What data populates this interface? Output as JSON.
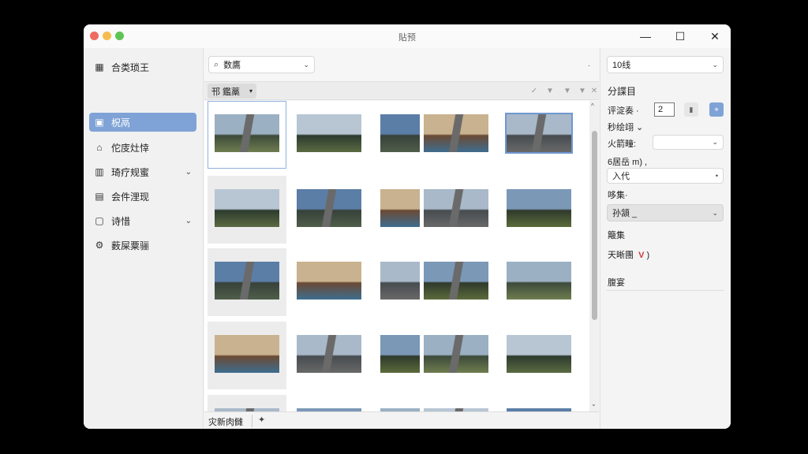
{
  "window": {
    "title": "貼预",
    "min_icon": "—",
    "max_icon": "☐",
    "close_icon": "✕"
  },
  "sidebar": {
    "items": [
      {
        "icon": "▦",
        "label": "合类琐王",
        "chevron": ""
      },
      {
        "icon": "▣",
        "label": "柷鬲",
        "chevron": ""
      },
      {
        "icon": "⌂",
        "label": "佗庋灶悻",
        "chevron": ""
      },
      {
        "icon": "▥",
        "label": "琦疗规蜜",
        "chevron": "⌄"
      },
      {
        "icon": "▤",
        "label": "会件浬现",
        "chevron": ""
      },
      {
        "icon": "▢",
        "label": "诗惜",
        "chevron": "⌄"
      },
      {
        "icon": "⚙",
        "label": "薮屎粟骊",
        "chevron": ""
      }
    ]
  },
  "toolbar": {
    "search_icon": "⌕",
    "search_value": "数鷹",
    "search_chevron": "⌄",
    "dot": "·",
    "sort_label": "邗 鑑藁",
    "sort_chevron": "▾",
    "tool_icons": [
      "✓",
      "▼",
      "▼",
      "▼",
      "✕"
    ]
  },
  "grid": {
    "scroll_up": "^",
    "scroll_down": "⌄"
  },
  "status": {
    "text": "灾新肉雠",
    "pin": "✦"
  },
  "panel": {
    "top_select": "10线",
    "top_chevron": "⌄",
    "section1": "分諜目",
    "rating_label": "评淀奏 ·",
    "rating_value": "2",
    "btn1": "▮",
    "btn2": "⌖",
    "sort_label": "秒绘翊 ⌄",
    "filter_label": "火箭疃:",
    "filter_chevron": "⌄",
    "size_label": "6居岳 m) ,",
    "size_value": "入代",
    "size_dot": "•",
    "change_label": "哆集·",
    "change_select": "孙頷 _",
    "change_chevron": "⌄",
    "tag_label": "簸集",
    "weather_label": "天晰團",
    "weather_mark": "V",
    "weather_suffix": ")",
    "location_label": "腹宴"
  },
  "colors": {
    "accent": "#7fa3d6",
    "selection": "#6f98d0",
    "weather_mark": "#d23a3a"
  }
}
